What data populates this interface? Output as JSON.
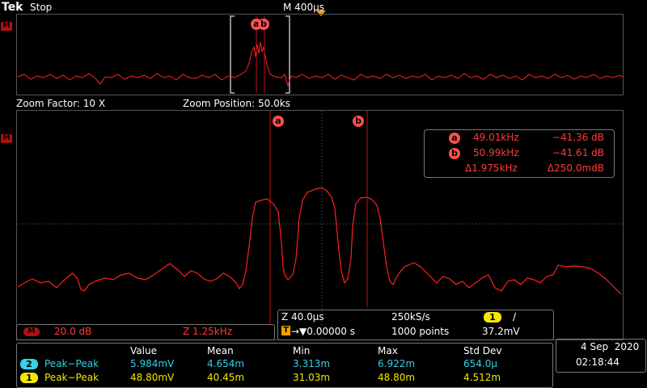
{
  "header": {
    "brand": "Tek",
    "run_status": "Stop",
    "horizontal_scale": "M 400µs"
  },
  "overview": {
    "channel_label": "M",
    "cursor_a_label": "a",
    "cursor_b_label": "b"
  },
  "zoom": {
    "factor": "Zoom Factor: 10 X",
    "position": "Zoom Position: 50.0ks"
  },
  "main": {
    "channel_label": "M",
    "cursor_a_label": "a",
    "cursor_b_label": "b"
  },
  "cursor_readout": {
    "a": {
      "label": "a",
      "freq": "49.01kHz",
      "level": "−41.36 dB"
    },
    "b": {
      "label": "b",
      "freq": "50.99kHz",
      "level": "−41.61 dB"
    },
    "delta": {
      "freq": "Δ1.975kHz",
      "level": "Δ250.0mdB"
    }
  },
  "math_info": {
    "label": "M",
    "vertical": "20.0 dB",
    "horizontal": "Z 1.25kHz"
  },
  "acquisition": {
    "zoom_time": "Z 40.0µs",
    "sample_rate": "250kS/s",
    "trigger_channel": "1",
    "trigger_slope": "/",
    "trigger_position": "→▼0.00000 s",
    "trigger_icon": "T",
    "record_length": "1000 points",
    "trigger_level": "37.2mV"
  },
  "measurements": {
    "headers": [
      "Value",
      "Mean",
      "Min",
      "Max",
      "Std Dev"
    ],
    "rows": [
      {
        "channel": "2",
        "name": "Peak−Peak",
        "values": [
          "5.984mV",
          "4.654m",
          "3.313m",
          "6.922m",
          "654.0µ"
        ]
      },
      {
        "channel": "1",
        "name": "Peak−Peak",
        "values": [
          "48.80mV",
          "40.45m",
          "31.03m",
          "48.80m",
          "4.512m"
        ]
      }
    ]
  },
  "datetime": {
    "date": "4 Sep  2020",
    "time": "02:18:44"
  },
  "colors": {
    "math": "#ff3a3a",
    "ch1": "#f4e800",
    "ch2": "#38d0e8",
    "trigger": "#f5a000"
  }
}
